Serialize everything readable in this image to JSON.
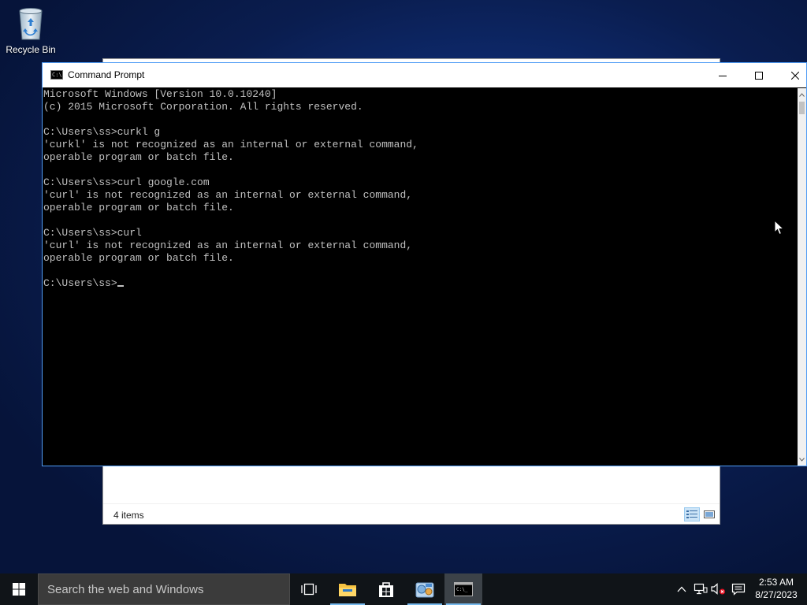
{
  "desktop": {
    "recycle_bin_label": "Recycle Bin"
  },
  "explorer": {
    "status_count": "4 items"
  },
  "cmd": {
    "title": "Command Prompt",
    "lines": [
      "Microsoft Windows [Version 10.0.10240]",
      "(c) 2015 Microsoft Corporation. All rights reserved.",
      "",
      "C:\\Users\\ss>curkl g",
      "'curkl' is not recognized as an internal or external command,",
      "operable program or batch file.",
      "",
      "C:\\Users\\ss>curl google.com",
      "'curl' is not recognized as an internal or external command,",
      "operable program or batch file.",
      "",
      "C:\\Users\\ss>curl",
      "'curl' is not recognized as an internal or external command,",
      "operable program or batch file.",
      ""
    ],
    "prompt": "C:\\Users\\ss>",
    "icon_text": "C:\\"
  },
  "taskbar": {
    "search_placeholder": "Search the web and Windows",
    "apps": [
      {
        "name": "task-view-icon"
      },
      {
        "name": "file-explorer-icon"
      },
      {
        "name": "store-icon"
      },
      {
        "name": "control-panel-icon"
      },
      {
        "name": "command-prompt-icon"
      }
    ],
    "clock_time": "2:53 AM",
    "clock_date": "8/27/2023"
  },
  "colors": {
    "console_text": "#c0c0c0",
    "console_bg": "#000000",
    "window_border": "#4f9cf5",
    "taskbar_bg": "#101418",
    "running_indicator": "#76b9ed"
  }
}
